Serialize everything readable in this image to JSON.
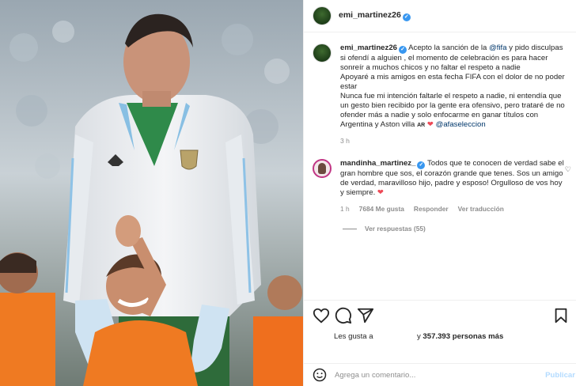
{
  "post": {
    "author": "emi_martinez26",
    "verified_mark": "✓"
  },
  "caption": {
    "username": "emi_martinez26",
    "text_part1": "Acepto la sanción de la ",
    "mention1": "@fifa",
    "text_part2": " y pido disculpas si ofendí a alguien , el momento de celebración es para hacer sonreír a muchos chicos y no faltar el respeto a nadie",
    "line2": "Apoyaré a mis amigos en esta fecha FIFA con el dolor de no poder estar",
    "line3": "Nunca fue mi intención faltarle el respeto a nadie, ni entendía que un gesto bien recibido por la gente era ofensivo, pero trataré de no ofender más a nadie y solo enfocarme en ganar títulos con Argentina y Aston villa ",
    "flag": "AR",
    "heart": "❤",
    "mention2": "@afaseleccion",
    "time": "3 h"
  },
  "comment": {
    "username": "mandinha_martinez_",
    "text": "Todos que te conocen de verdad sabe el gran hombre que sos, el corazón grande que tenes. Sos un amigo de verdad, maravilloso hijo, padre y esposo! Orgulloso de vos hoy y siempre. ",
    "heart": "❤",
    "time": "1 h",
    "likes": "7684 Me gusta",
    "reply": "Responder",
    "translate": "Ver traducción",
    "view_replies": "Ver respuestas (55)",
    "like_icon": "♡"
  },
  "actions": {
    "likes_prefix": "Les gusta a",
    "likes_suffix": "357.393 personas más",
    "icons": [
      "heart-icon",
      "comment-icon",
      "share-icon",
      "bookmark-icon"
    ]
  },
  "add_comment": {
    "emoji_icon": "emoji-icon",
    "placeholder": "Agrega un comentario...",
    "publish": "Publicar"
  },
  "colors": {
    "link": "#00376b",
    "verified": "#3897f0",
    "heart": "#ed4956",
    "muted": "#8e8e8e",
    "publish_disabled": "#b3dbff"
  }
}
